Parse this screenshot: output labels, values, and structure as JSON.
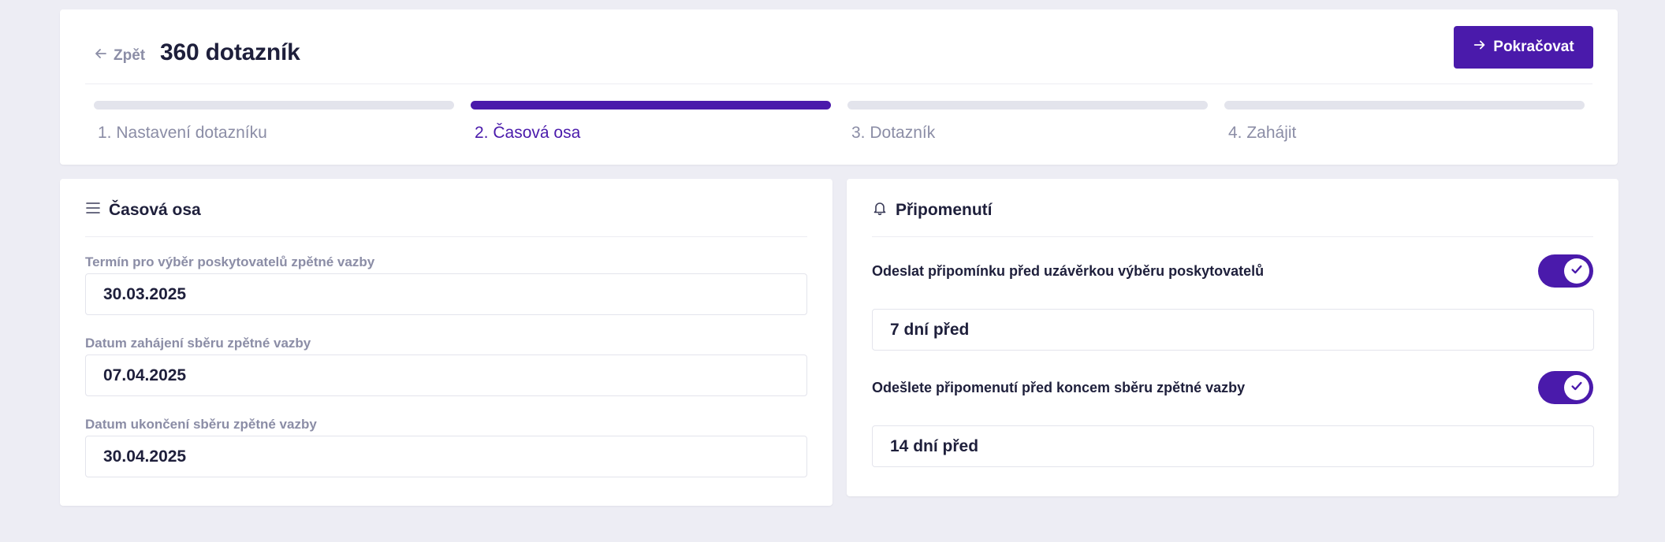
{
  "header": {
    "back_label": "Zpět",
    "title": "360 dotazník",
    "continue_label": "Pokračovat"
  },
  "steps": [
    {
      "label": "1. Nastavení dotazníku",
      "active": false
    },
    {
      "label": "2. Časová osa",
      "active": true
    },
    {
      "label": "3. Dotazník",
      "active": false
    },
    {
      "label": "4. Zahájit",
      "active": false
    }
  ],
  "timeline": {
    "title": "Časová osa",
    "icon": "list-icon",
    "fields": [
      {
        "label": "Termín pro výběr poskytovatelů zpětné vazby",
        "value": "30.03.2025"
      },
      {
        "label": "Datum zahájení sběru zpětné vazby",
        "value": "07.04.2025"
      },
      {
        "label": "Datum ukončení sběru zpětné vazby",
        "value": "30.04.2025"
      }
    ]
  },
  "reminders": {
    "title": "Připomenutí",
    "icon": "bell-icon",
    "items": [
      {
        "label": "Odeslat připomínku před uzávěrkou výběru poskytovatelů",
        "enabled": true,
        "value": "7 dní před"
      },
      {
        "label": "Odešlete připomenutí před koncem sběru zpětné vazby",
        "enabled": true,
        "value": "14 dní před"
      }
    ]
  },
  "colors": {
    "accent": "#4a1aab",
    "background": "#ededf4",
    "muted_text": "#8b8da6",
    "text": "#1e1f3b"
  }
}
